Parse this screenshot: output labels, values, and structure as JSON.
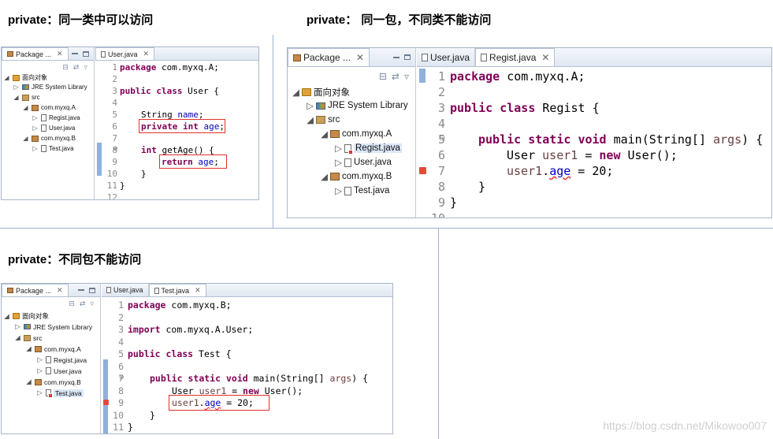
{
  "captions": {
    "top_left": {
      "keyword": "private",
      "rest": "：同一类中可以访问"
    },
    "top_right": {
      "keyword": "private",
      "rest": "： 同一包，不同类不能访问"
    },
    "bottom_left": {
      "keyword": "private",
      "rest": "：不同包不能访问"
    }
  },
  "panel1": {
    "explorer_tab": "Package ...",
    "tree": {
      "project": "面向对象",
      "library": "JRE System Library",
      "src": "src",
      "pkg_a": "com.myxq.A",
      "pkg_a_files": [
        "Regist.java",
        "User.java"
      ],
      "pkg_b": "com.myxq.B",
      "pkg_b_files": [
        "Test.java"
      ]
    },
    "editor_tabs": [
      "User.java"
    ],
    "line_numbers": [
      "1",
      "2",
      "3",
      "4",
      "5",
      "6",
      "7",
      "8",
      "9",
      "10",
      "11",
      "12"
    ],
    "code": {
      "l1_kw": "package",
      "l1_rest": " com.myxq.A;",
      "l3_kw1": "public",
      "l3_kw2": "class",
      "l3_rest": " User {",
      "l5_type": "String ",
      "l5_field": "name",
      "l5_end": ";",
      "l6_kw1": "private",
      "l6_kw2": "int",
      "l6_field": "age",
      "l6_end": ";",
      "l8_kw": "int",
      "l8_rest": " getAge() {",
      "l9_kw": "return",
      "l9_field": "age",
      "l9_end": ";",
      "l10": "}",
      "l11": "}"
    }
  },
  "panel2": {
    "explorer_tab": "Package ...",
    "tree": {
      "project": "面向对象",
      "library": "JRE System Library",
      "src": "src",
      "pkg_a": "com.myxq.A",
      "pkg_a_files": [
        "Regist.java",
        "User.java"
      ],
      "pkg_b": "com.myxq.B",
      "pkg_b_files": [
        "Test.java"
      ]
    },
    "editor_tabs": [
      "User.java",
      "Regist.java"
    ],
    "line_numbers": [
      "1",
      "2",
      "3",
      "4",
      "5",
      "6",
      "7",
      "8",
      "9",
      "10"
    ],
    "code": {
      "l1_kw": "package",
      "l1_rest": " com.myxq.A;",
      "l3_kw1": "public",
      "l3_kw2": "class",
      "l3_rest": " Regist {",
      "l5_kw1": "public",
      "l5_kw2": "static",
      "l5_kw3": "void",
      "l5_rest": " main(String[] ",
      "l5_arg": "args",
      "l5_end": ") {",
      "l6_type": "User ",
      "l6_var": "user1",
      "l6_mid": " = ",
      "l6_kw": "new",
      "l6_end": " User();",
      "l7_var": "user1",
      "l7_dot": ".",
      "l7_field": "age",
      "l7_end": " = 20;",
      "l8": "}",
      "l9": "}"
    }
  },
  "panel3": {
    "explorer_tab": "Package ...",
    "tree": {
      "project": "面向对象",
      "library": "JRE System Library",
      "src": "src",
      "pkg_a": "com.myxq.A",
      "pkg_a_files": [
        "Regist.java",
        "User.java"
      ],
      "pkg_b": "com.myxq.B",
      "pkg_b_files": [
        "Test.java"
      ]
    },
    "editor_tabs": [
      "User.java",
      "Test.java"
    ],
    "line_numbers": [
      "1",
      "2",
      "3",
      "4",
      "5",
      "6",
      "7",
      "8",
      "9",
      "10",
      "11"
    ],
    "code": {
      "l1_kw": "package",
      "l1_rest": " com.myxq.B;",
      "l3_kw": "import",
      "l3_rest": " com.myxq.A.User;",
      "l5_kw1": "public",
      "l5_kw2": "class",
      "l5_rest": " Test {",
      "l7_kw1": "public",
      "l7_kw2": "static",
      "l7_kw3": "void",
      "l7_rest": " main(String[] ",
      "l7_arg": "args",
      "l7_end": ") {",
      "l8_type": "User ",
      "l8_var": "user1",
      "l8_mid": " = ",
      "l8_kw": "new",
      "l8_end": " User();",
      "l9_var": "user1",
      "l9_dot": ".",
      "l9_field": "age",
      "l9_end": " = 20;",
      "l10": "}",
      "l11": "}"
    }
  },
  "watermark": "https://blog.csdn.net/Mikowoo007"
}
